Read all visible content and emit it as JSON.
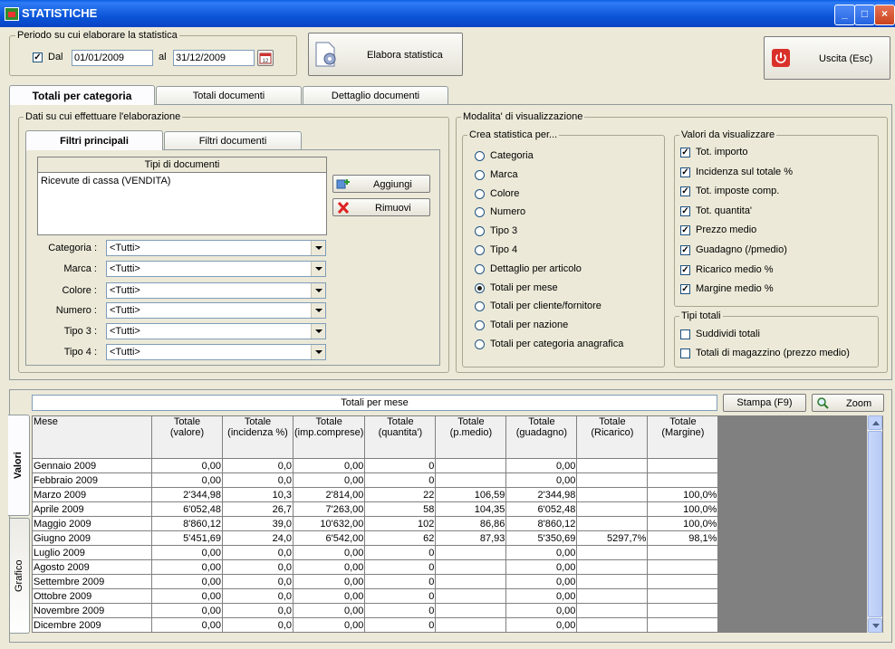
{
  "window": {
    "title": "STATISTICHE"
  },
  "period": {
    "group_label": "Periodo su cui elaborare la statistica",
    "dal_label": "Dal",
    "dal_checked": true,
    "date_from": "01/01/2009",
    "al_label": "al",
    "date_to": "31/12/2009"
  },
  "toolbar": {
    "elabora_label": "Elabora statistica",
    "uscita_label": "Uscita (Esc)"
  },
  "main_tabs": [
    {
      "label": "Totali per categoria",
      "active": true
    },
    {
      "label": "Totali documenti",
      "active": false
    },
    {
      "label": "Dettaglio documenti",
      "active": false
    }
  ],
  "dati": {
    "group_label": "Dati su cui effettuare l'elaborazione",
    "sub_tabs": [
      {
        "label": "Filtri principali",
        "active": true
      },
      {
        "label": "Filtri documenti",
        "active": false
      }
    ],
    "tipi_header": "Tipi di documenti",
    "tipi_items": [
      "Ricevute di cassa (VENDITA)"
    ],
    "aggiungi_label": "Aggiungi",
    "rimuovi_label": "Rimuovi",
    "filters": [
      {
        "label": "Categoria :",
        "value": "<Tutti>"
      },
      {
        "label": "Marca :",
        "value": "<Tutti>"
      },
      {
        "label": "Colore :",
        "value": "<Tutti>"
      },
      {
        "label": "Numero :",
        "value": "<Tutti>"
      },
      {
        "label": "Tipo 3 :",
        "value": "<Tutti>"
      },
      {
        "label": "Tipo 4 :",
        "value": "<Tutti>"
      }
    ]
  },
  "modalita": {
    "group_label": "Modalita' di visualizzazione",
    "crea_label": "Crea statistica per...",
    "crea_options": [
      {
        "label": "Categoria",
        "selected": false
      },
      {
        "label": "Marca",
        "selected": false
      },
      {
        "label": "Colore",
        "selected": false
      },
      {
        "label": "Numero",
        "selected": false
      },
      {
        "label": "Tipo 3",
        "selected": false
      },
      {
        "label": "Tipo 4",
        "selected": false
      },
      {
        "label": "Dettaglio per articolo",
        "selected": false
      },
      {
        "label": "Totali per mese",
        "selected": true
      },
      {
        "label": "Totali per cliente/fornitore",
        "selected": false
      },
      {
        "label": "Totali per nazione",
        "selected": false
      },
      {
        "label": "Totali per categoria anagrafica",
        "selected": false
      }
    ],
    "valori_label": "Valori da visualizzare",
    "valori_options": [
      {
        "label": "Tot. importo",
        "checked": true
      },
      {
        "label": "Incidenza sul totale %",
        "checked": true
      },
      {
        "label": "Tot. imposte comp.",
        "checked": true
      },
      {
        "label": "Tot. quantita'",
        "checked": true
      },
      {
        "label": "Prezzo medio",
        "checked": true
      },
      {
        "label": "Guadagno (/pmedio)",
        "checked": true
      },
      {
        "label": "Ricarico medio %",
        "checked": true
      },
      {
        "label": "Margine medio %",
        "checked": true
      }
    ],
    "tipi_totali_label": "Tipi totali",
    "tipi_totali_options": [
      {
        "label": "Suddividi totali",
        "checked": false
      },
      {
        "label": "Totali di magazzino (prezzo medio)",
        "checked": false
      }
    ]
  },
  "results": {
    "side_tabs": [
      {
        "label": "Valori",
        "active": true
      },
      {
        "label": "Grafico",
        "active": false
      }
    ],
    "title": "Totali per mese",
    "stampa_label": "Stampa (F9)",
    "zoom_label": "Zoom",
    "columns": [
      "Mese",
      "Totale\n(valore)",
      "Totale\n(incidenza %)",
      "Totale\n(imp.comprese)",
      "Totale\n(quantita')",
      "Totale\n(p.medio)",
      "Totale\n(guadagno)",
      "Totale\n(Ricarico)",
      "Totale\n(Margine)"
    ],
    "rows": [
      [
        "Gennaio 2009",
        "0,00",
        "0,0",
        "0,00",
        "0",
        "",
        "0,00",
        "",
        ""
      ],
      [
        "Febbraio 2009",
        "0,00",
        "0,0",
        "0,00",
        "0",
        "",
        "0,00",
        "",
        ""
      ],
      [
        "Marzo 2009",
        "2'344,98",
        "10,3",
        "2'814,00",
        "22",
        "106,59",
        "2'344,98",
        "",
        "100,0%"
      ],
      [
        "Aprile 2009",
        "6'052,48",
        "26,7",
        "7'263,00",
        "58",
        "104,35",
        "6'052,48",
        "",
        "100,0%"
      ],
      [
        "Maggio 2009",
        "8'860,12",
        "39,0",
        "10'632,00",
        "102",
        "86,86",
        "8'860,12",
        "",
        "100,0%"
      ],
      [
        "Giugno 2009",
        "5'451,69",
        "24,0",
        "6'542,00",
        "62",
        "87,93",
        "5'350,69",
        "5297,7%",
        "98,1%"
      ],
      [
        "Luglio 2009",
        "0,00",
        "0,0",
        "0,00",
        "0",
        "",
        "0,00",
        "",
        ""
      ],
      [
        "Agosto 2009",
        "0,00",
        "0,0",
        "0,00",
        "0",
        "",
        "0,00",
        "",
        ""
      ],
      [
        "Settembre 2009",
        "0,00",
        "0,0",
        "0,00",
        "0",
        "",
        "0,00",
        "",
        ""
      ],
      [
        "Ottobre 2009",
        "0,00",
        "0,0",
        "0,00",
        "0",
        "",
        "0,00",
        "",
        ""
      ],
      [
        "Novembre 2009",
        "0,00",
        "0,0",
        "0,00",
        "0",
        "",
        "0,00",
        "",
        ""
      ],
      [
        "Dicembre 2009",
        "0,00",
        "0,0",
        "0,00",
        "0",
        "",
        "0,00",
        "",
        ""
      ]
    ]
  },
  "icons": {
    "app": "app-icon",
    "calendar": "calendar-icon",
    "elabora": "document-gear-icon",
    "uscita": "power-icon",
    "aggiungi": "add-icon",
    "rimuovi": "remove-x-icon",
    "zoom": "magnifier-icon"
  }
}
